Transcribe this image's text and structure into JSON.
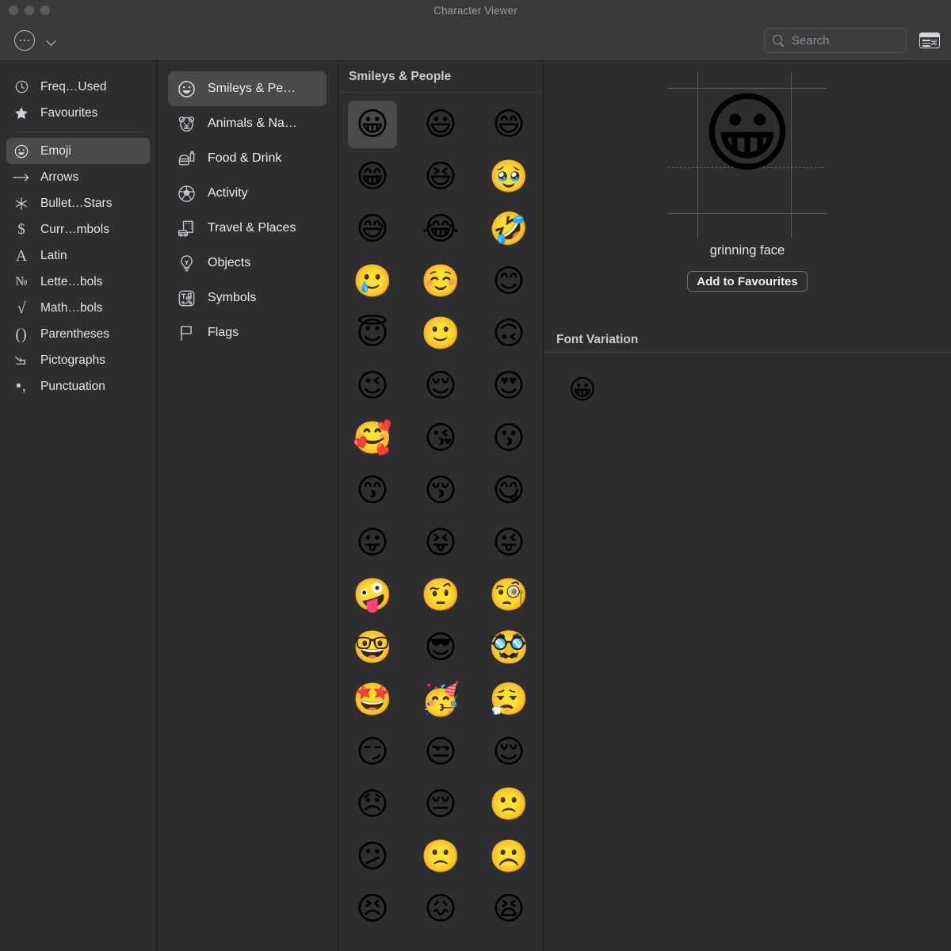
{
  "window": {
    "title": "Character Viewer",
    "traffic_lights": [
      "close-button",
      "minimize-button",
      "zoom-button"
    ]
  },
  "toolbar": {
    "more_button_label": "…",
    "dropdown_label": "",
    "search": {
      "placeholder": "Search",
      "value": "",
      "icon": "search-icon"
    },
    "panel_toggle_icon": "character-palette-icon"
  },
  "sidebar": {
    "items": [
      {
        "label": "Freq…Used",
        "icon": "clock-icon",
        "selected": false
      },
      {
        "label": "Favourites",
        "icon": "star-icon",
        "selected": false
      },
      {
        "label": "Emoji",
        "icon": "smiley-icon",
        "selected": true
      },
      {
        "label": "Arrows",
        "icon": "arrow-right-icon",
        "selected": false
      },
      {
        "label": "Bullet…Stars",
        "icon": "asterisk-icon",
        "selected": false
      },
      {
        "label": "Curr…mbols",
        "icon": "dollar-icon",
        "selected": false
      },
      {
        "label": "Latin",
        "icon": "letter-a-icon",
        "selected": false
      },
      {
        "label": "Lette…bols",
        "icon": "numero-icon",
        "selected": false
      },
      {
        "label": "Math…bols",
        "icon": "radical-icon",
        "selected": false
      },
      {
        "label": "Parentheses",
        "icon": "parentheses-icon",
        "selected": false
      },
      {
        "label": "Pictographs",
        "icon": "pictograph-icon",
        "selected": false
      },
      {
        "label": "Punctuation",
        "icon": "punctuation-icon",
        "selected": false
      }
    ],
    "divider_after_index": 1
  },
  "categories": {
    "items": [
      {
        "label": "Smileys & Pe…",
        "icon": "smiley-icon",
        "selected": true
      },
      {
        "label": "Animals & Na…",
        "icon": "bear-icon",
        "selected": false
      },
      {
        "label": "Food & Drink",
        "icon": "burger-icon",
        "selected": false
      },
      {
        "label": "Activity",
        "icon": "soccer-icon",
        "selected": false
      },
      {
        "label": "Travel & Places",
        "icon": "car-city-icon",
        "selected": false
      },
      {
        "label": "Objects",
        "icon": "bulb-icon",
        "selected": false
      },
      {
        "label": "Symbols",
        "icon": "symbols-icon",
        "selected": false
      },
      {
        "label": "Flags",
        "icon": "flag-icon",
        "selected": false
      }
    ]
  },
  "grid": {
    "header": "Smileys & People",
    "selected_index": 0,
    "emoji": [
      "😀",
      "😃",
      "😄",
      "😁",
      "😆",
      "🥹",
      "😅",
      "😂",
      "🤣",
      "🥲",
      "☺️",
      "😊",
      "😇",
      "🙂",
      "🙃",
      "😉",
      "😌",
      "😍",
      "🥰",
      "😘",
      "😗",
      "😙",
      "😚",
      "😋",
      "😛",
      "😝",
      "😜",
      "🤪",
      "🤨",
      "🧐",
      "🤓",
      "😎",
      "🥸",
      "🤩",
      "🥳",
      "😮‍💨",
      "😏",
      "😒",
      "😌",
      "😞",
      "😔",
      "🙁",
      "😕",
      "🙁",
      "☹️",
      "😣",
      "😖",
      "😫"
    ]
  },
  "detail": {
    "preview_glyph": "😀",
    "character_name": "grinning face",
    "add_to_favourites_label": "Add to Favourites",
    "font_variation_header": "Font Variation",
    "font_variations": [
      "😀"
    ]
  },
  "colors": {
    "window_background": "#2c2c2e",
    "panel_background": "#2e2e30",
    "titlebar_background": "#3a3a3c",
    "selection": "#4a4a4c",
    "separator": "#1d1d1f",
    "text_primary": "#e4e4e6",
    "text_secondary": "#9a9a9e",
    "emoji_yellow": "#f5c33b"
  }
}
